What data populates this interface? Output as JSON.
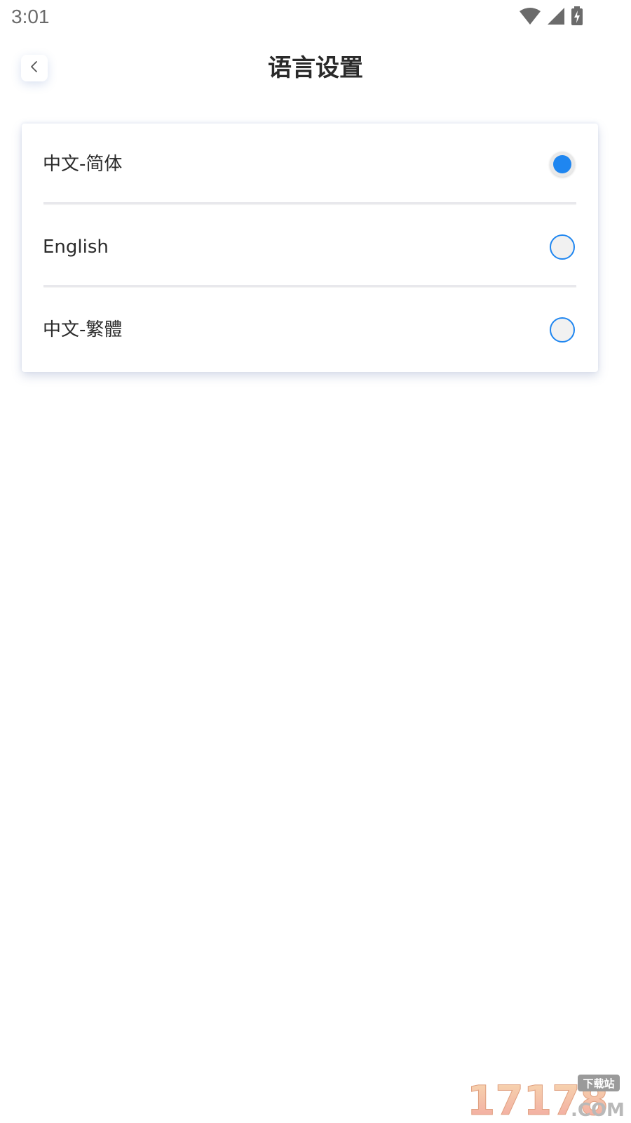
{
  "status_bar": {
    "time": "3:01",
    "icons": [
      "wifi-icon",
      "cellular-signal-icon",
      "battery-charging-icon"
    ]
  },
  "header": {
    "title": "语言设置",
    "back_icon": "chevron-left-icon"
  },
  "languages": [
    {
      "label": "中文-简体",
      "selected": true
    },
    {
      "label": "English",
      "selected": false
    },
    {
      "label": "中文-繁體",
      "selected": false
    }
  ],
  "colors": {
    "accent": "#1f86f0",
    "title_text": "#2a2a2a",
    "body_text": "#2b2b2b",
    "status_text": "#6b6b6b",
    "divider": "#e8e8ec"
  },
  "watermark": {
    "number": "17178",
    "tag": "下载站",
    "domain": ".COM"
  }
}
